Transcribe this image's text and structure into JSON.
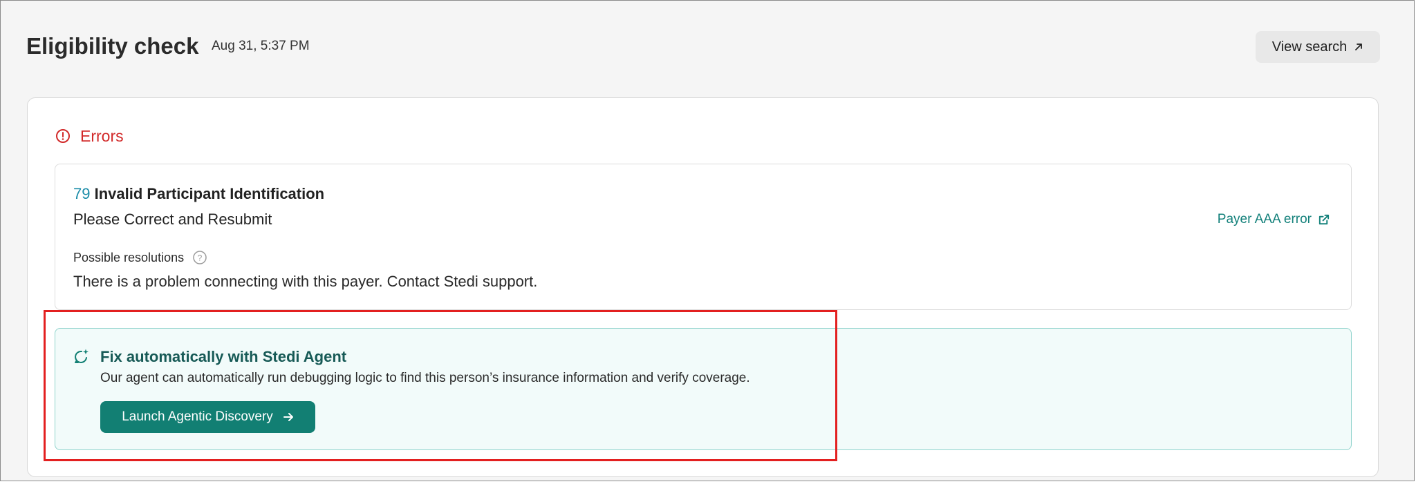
{
  "header": {
    "title": "Eligibility check",
    "timestamp": "Aug 31, 5:37 PM",
    "view_search_label": "View search"
  },
  "errors": {
    "section_label": "Errors",
    "item": {
      "code": "79",
      "name": "Invalid Participant Identification",
      "subtitle": "Please Correct and Resubmit",
      "payer_link_label": "Payer AAA error",
      "resolutions_label": "Possible resolutions",
      "resolution_text": "There is a problem connecting with this payer. Contact Stedi support."
    }
  },
  "agent": {
    "title": "Fix automatically with Stedi Agent",
    "description": "Our agent can automatically run debugging logic to find this person’s insurance information and verify coverage.",
    "button_label": "Launch Agentic Discovery"
  },
  "icons": {
    "view_search": "arrow-up-right-icon",
    "errors": "alert-circle-icon",
    "payer_link": "external-link-icon",
    "resolutions": "help-circle-icon",
    "agent": "sparkle-refresh-icon",
    "launch": "arrow-right-icon"
  },
  "colors": {
    "error_red": "#d22a2a",
    "accent_teal": "#127f73",
    "code_blue": "#1b8ca8",
    "highlight_red": "#e32020",
    "agent_bg": "#f2fbfa"
  }
}
